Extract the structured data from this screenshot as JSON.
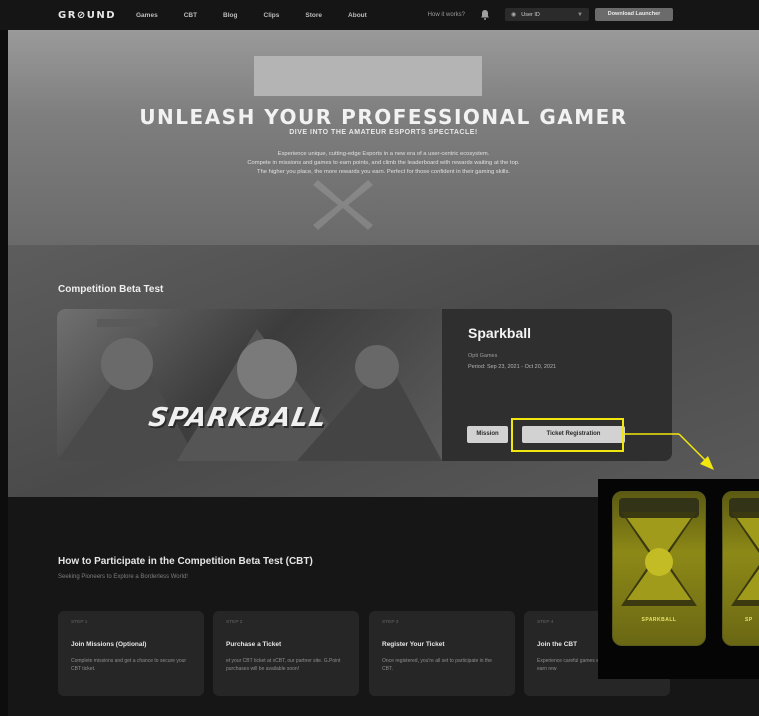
{
  "nav": {
    "logo": "GR⊘UND",
    "links": [
      "Games",
      "CBT",
      "Blog",
      "Clips",
      "Store",
      "About"
    ],
    "how_it_works": "How it works?",
    "user_id": "User ID",
    "download": "Download Launcher"
  },
  "hero": {
    "title": "UNLEASH YOUR PROFESSIONAL GAMER",
    "subtitle": "DIVE INTO THE AMATEUR ESPORTS SPECTACLE!",
    "desc_line1": "Experience unique, cutting-edge Esports in a new era of a user-centric ecosystem.",
    "desc_line2": "Compete in missions and games to earn points, and climb the leaderboard with rewards waiting at the top.",
    "desc_line3": "The higher you place, the more rewards you earn. Perfect for those confident in their gaming skills."
  },
  "cbt": {
    "heading": "Competition Beta Test",
    "game_logo": "SPARKBALL",
    "game_name": "Sparkball",
    "publisher": "Opti Games",
    "period": "Period: Sep 23, 2021 - Oct 20, 2021",
    "mission_label": "Mission",
    "ticket_label": "Ticket Registration"
  },
  "participate": {
    "title": "How to Participate in the Competition Beta Test (CBT)",
    "subtitle": "Seeking Pioneers to Explore a Borderless World!",
    "steps": [
      {
        "num": "STEP 1",
        "title": "Join Missions (Optional)",
        "desc": "Complete missions and get a chance to secure your CBT ticket."
      },
      {
        "num": "STEP 2",
        "title": "Purchase a Ticket",
        "desc": "et your CBT ticket at xCBT, our partner site. G.Point purchases will be available soon!"
      },
      {
        "num": "STEP 3",
        "title": "Register Your Ticket",
        "desc": "Once registered, you're all set to participate in the CBT."
      },
      {
        "num": "STEP 4",
        "title": "Join the CBT",
        "desc": "Experience careful games every month skills and earn rew"
      }
    ]
  },
  "callout": {
    "card_label": "SPARKBALL",
    "card2_label": "SP"
  },
  "colors": {
    "highlight": "#f2e60f",
    "nav_bg": "#151515"
  }
}
